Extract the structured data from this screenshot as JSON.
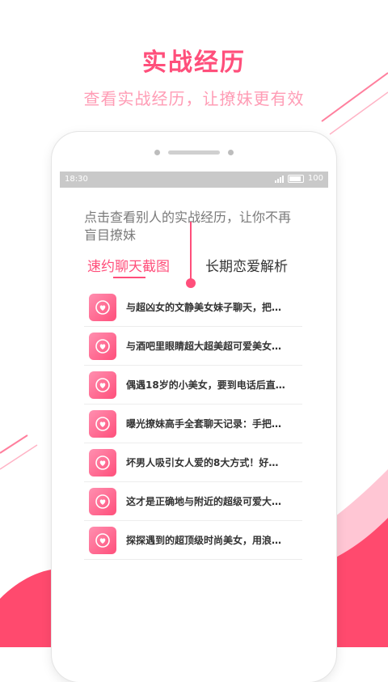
{
  "header": {
    "title": "实战经历",
    "subtitle": "查看实战经历，让撩妹更有效"
  },
  "status_bar": {
    "time": "18:30",
    "battery": "100"
  },
  "content": {
    "intro": "点击查看别人的实战经历，让你不再盲目撩妹",
    "tabs": [
      "速约聊天截图",
      "长期恋爱解析"
    ],
    "items": [
      "与超凶女的文静美女妹子聊天，把…",
      "与酒吧里眼睛超大超美超可爱美女…",
      "偶遇18岁的小美女，要到电话后直…",
      "曝光撩妹高手全套聊天记录：手把…",
      "坏男人吸引女人爱的8大方式！好…",
      "这才是正确地与附近的超级可爱大…",
      "探探遇到的超顶级时尚美女，用浪…"
    ]
  },
  "colors": {
    "accent": "#ff4f7b",
    "accent_light": "#ff9cb5",
    "wave_dark": "#ff4a6e",
    "wave_light": "#ffc6d4"
  },
  "icons": {
    "item_icon": "heart-chat-icon"
  }
}
